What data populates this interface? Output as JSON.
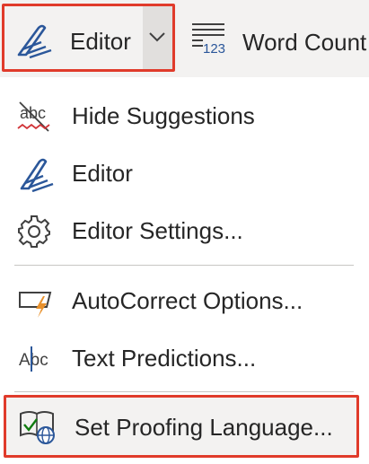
{
  "ribbon": {
    "editor_button": {
      "label": "Editor",
      "icon": "editor-pen-icon"
    },
    "editor_dropdown": {
      "icon": "chevron-down-icon"
    },
    "word_count_button": {
      "label": "Word Count",
      "icon": "word-count-icon",
      "icon_text": "123"
    }
  },
  "menu": {
    "items": [
      {
        "label": "Hide Suggestions",
        "icon": "hide-suggestions-icon",
        "icon_text": "abc"
      },
      {
        "label": "Editor",
        "icon": "editor-pen-icon"
      },
      {
        "label": "Editor Settings...",
        "icon": "gear-icon"
      },
      {
        "label": "AutoCorrect Options...",
        "icon": "autocorrect-icon"
      },
      {
        "label": "Text Predictions...",
        "icon": "text-predictions-icon",
        "icon_text": "Abc"
      },
      {
        "label": "Set Proofing Language...",
        "icon": "proofing-language-icon"
      }
    ]
  },
  "colors": {
    "highlight_border": "#e03b2b",
    "ribbon_bg": "#f3f2f1",
    "icon_blue": "#2b579a",
    "accent_orange": "#e8912d",
    "squiggle_red": "#d13438",
    "check_green": "#107c10"
  }
}
